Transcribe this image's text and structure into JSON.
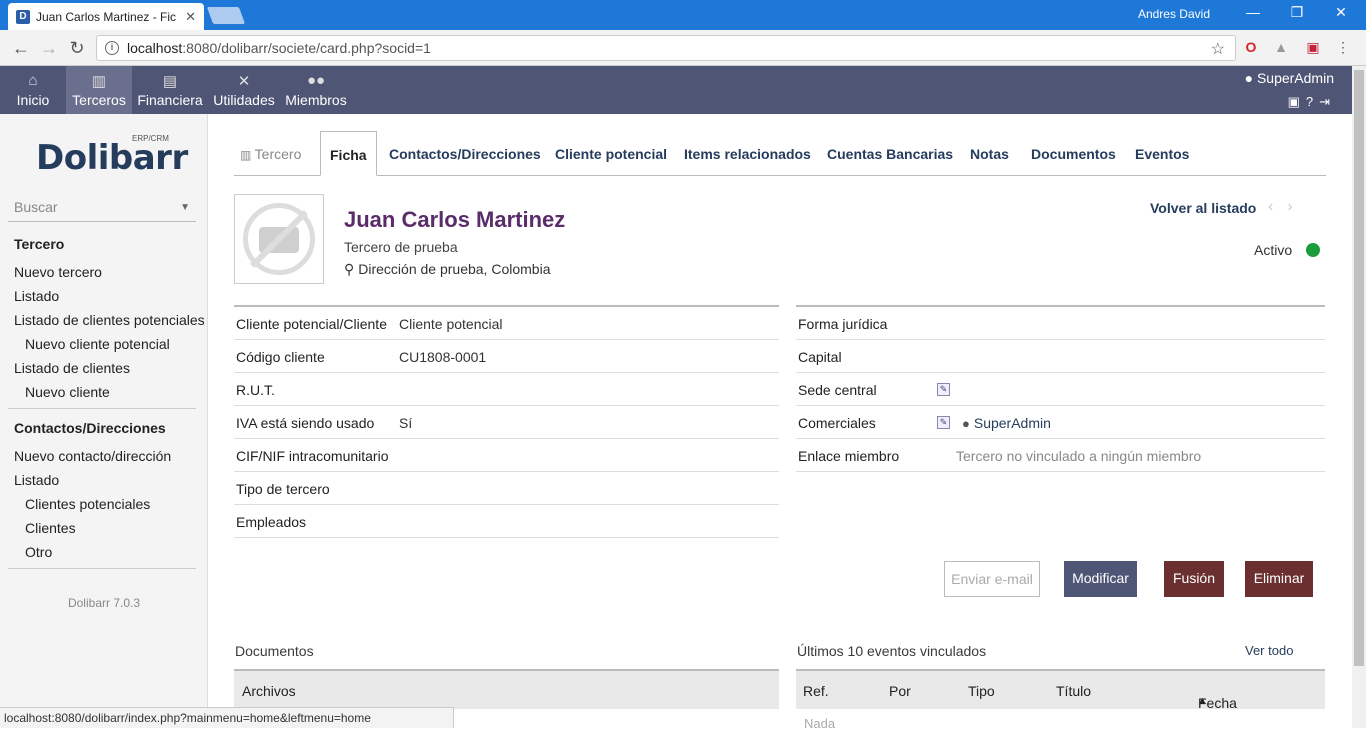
{
  "browser": {
    "tab_title": "Juan Carlos Martinez - Fic",
    "user_name": "Andres David",
    "url_host": "localhost",
    "url_rest": ":8080/dolibarr/societe/card.php?socid=1",
    "status_url": "localhost:8080/dolibarr/index.php?mainmenu=home&leftmenu=home"
  },
  "topmenu": {
    "items": [
      {
        "label": "Inicio",
        "icon": "home-icon"
      },
      {
        "label": "Terceros",
        "icon": "building-icon"
      },
      {
        "label": "Financiera",
        "icon": "coins-icon"
      },
      {
        "label": "Utilidades",
        "icon": "tools-icon"
      },
      {
        "label": "Miembros",
        "icon": "members-icon"
      }
    ],
    "user": "SuperAdmin"
  },
  "left": {
    "logo": "Dolibarr",
    "logo_tag": "ERP/CRM",
    "search_placeholder": "Buscar",
    "menu": [
      {
        "label": "Tercero",
        "style": "b"
      },
      {
        "label": "Nuevo tercero",
        "style": ""
      },
      {
        "label": "Listado",
        "style": ""
      },
      {
        "label": "Listado de clientes potenciales",
        "style": ""
      },
      {
        "label": "Nuevo cliente potencial",
        "style": "i"
      },
      {
        "label": "Listado de clientes",
        "style": ""
      },
      {
        "label": "Nuevo cliente",
        "style": "i"
      },
      {
        "label": "Contactos/Direcciones",
        "style": "b"
      },
      {
        "label": "Nuevo contacto/dirección",
        "style": ""
      },
      {
        "label": "Listado",
        "style": ""
      },
      {
        "label": "Clientes potenciales",
        "style": "i"
      },
      {
        "label": "Clientes",
        "style": "i"
      },
      {
        "label": "Otro",
        "style": "i"
      }
    ],
    "version": "Dolibarr 7.0.3"
  },
  "tabs": [
    "Tercero",
    "Ficha",
    "Contactos/Direcciones",
    "Cliente potencial",
    "Items relacionados",
    "Cuentas Bancarias",
    "Notas",
    "Documentos",
    "Eventos"
  ],
  "header": {
    "name": "Juan Carlos Martinez",
    "subtitle": "Tercero de prueba",
    "address": "Dirección de prueba, Colombia",
    "back_link": "Volver al listado",
    "status": "Activo"
  },
  "fields_left": [
    {
      "k": "Cliente potencial/Cliente",
      "v": "Cliente potencial"
    },
    {
      "k": "Código cliente",
      "v": "CU1808-0001"
    },
    {
      "k": "R.U.T.",
      "v": ""
    },
    {
      "k": "IVA está siendo usado",
      "v": "Sí"
    },
    {
      "k": "CIF/NIF intracomunitario",
      "v": ""
    },
    {
      "k": "Tipo de tercero",
      "v": ""
    },
    {
      "k": "Empleados",
      "v": ""
    }
  ],
  "fields_right": [
    {
      "k": "Forma jurídica",
      "v": ""
    },
    {
      "k": "Capital",
      "v": ""
    },
    {
      "k": "Sede central",
      "v": ""
    },
    {
      "k": "Comerciales",
      "v": "SuperAdmin"
    },
    {
      "k": "Enlace miembro",
      "v": "Tercero no vinculado a ningún miembro"
    }
  ],
  "buttons": {
    "mail": "Enviar e-mail",
    "modify": "Modificar",
    "merge": "Fusión",
    "delete": "Eliminar"
  },
  "documents": {
    "title": "Documentos",
    "header": "Archivos"
  },
  "events": {
    "title": "Últimos 10 eventos vinculados",
    "see_all": "Ver todo",
    "columns": [
      "Ref.",
      "Por",
      "Tipo",
      "Título",
      "Fecha"
    ],
    "empty": "Nada"
  }
}
